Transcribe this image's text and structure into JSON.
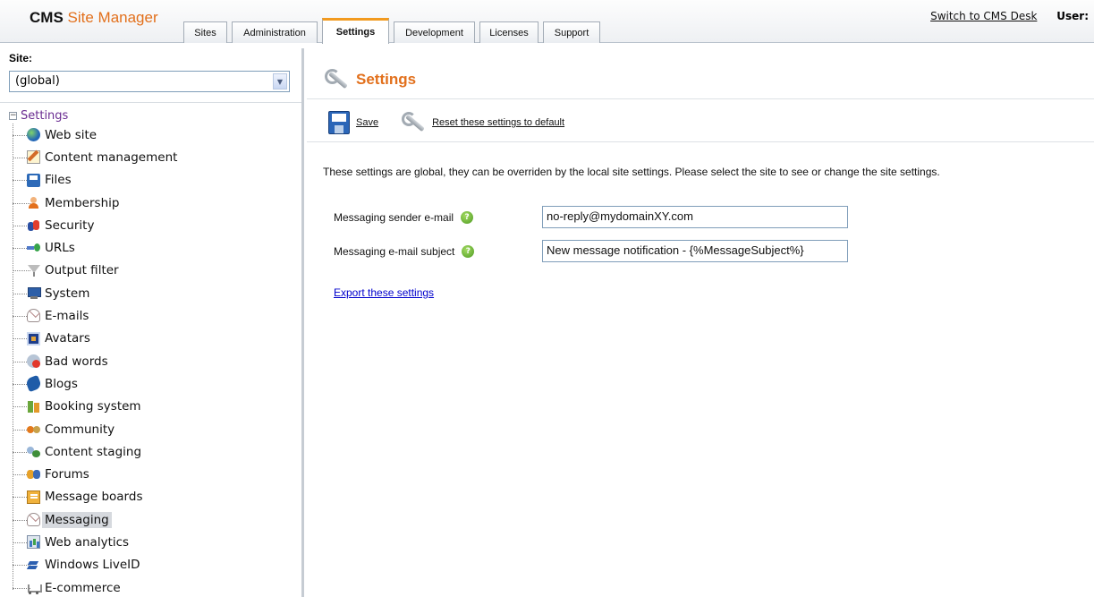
{
  "header": {
    "logo_bold": "CMS",
    "logo_text": "Site Manager",
    "tabs": [
      {
        "label": "Sites"
      },
      {
        "label": "Administration"
      },
      {
        "label": "Settings"
      },
      {
        "label": "Development"
      },
      {
        "label": "Licenses"
      },
      {
        "label": "Support"
      }
    ],
    "active_tab": "Settings",
    "switch_link": "Switch to CMS Desk",
    "user_label": "User:"
  },
  "sidebar": {
    "site_label": "Site:",
    "site_value": "(global)",
    "tree_root": "Settings",
    "tree_root_toggle": "−",
    "items": [
      {
        "label": "Web site",
        "icon": "globe-icon"
      },
      {
        "label": "Content management",
        "icon": "content-edit-icon"
      },
      {
        "label": "Files",
        "icon": "floppy-icon"
      },
      {
        "label": "Membership",
        "icon": "person-icon"
      },
      {
        "label": "Security",
        "icon": "security-icon"
      },
      {
        "label": "URLs",
        "icon": "urls-icon"
      },
      {
        "label": "Output filter",
        "icon": "filter-icon"
      },
      {
        "label": "System",
        "icon": "computer-icon"
      },
      {
        "label": "E-mails",
        "icon": "email-icon"
      },
      {
        "label": "Avatars",
        "icon": "avatar-icon"
      },
      {
        "label": "Bad words",
        "icon": "bad-words-icon"
      },
      {
        "label": "Blogs",
        "icon": "blog-icon"
      },
      {
        "label": "Booking system",
        "icon": "booking-icon"
      },
      {
        "label": "Community",
        "icon": "community-icon"
      },
      {
        "label": "Content staging",
        "icon": "staging-icon"
      },
      {
        "label": "Forums",
        "icon": "forums-icon"
      },
      {
        "label": "Message boards",
        "icon": "message-board-icon"
      },
      {
        "label": "Messaging",
        "icon": "messaging-icon",
        "selected": true
      },
      {
        "label": "Web analytics",
        "icon": "analytics-icon"
      },
      {
        "label": "Windows LiveID",
        "icon": "liveid-icon"
      },
      {
        "label": "E-commerce",
        "icon": "cart-icon"
      }
    ]
  },
  "main": {
    "title": "Settings",
    "toolbar": {
      "save_label": "Save",
      "reset_label": "Reset these settings to default"
    },
    "info_text": "These settings are global, they can be overriden by the local site settings. Please select the site to see or change the site settings.",
    "fields": [
      {
        "label": "Messaging sender e-mail",
        "value": "no-reply@mydomainXY.com"
      },
      {
        "label": "Messaging e-mail subject",
        "value": "New message notification - {%MessageSubject%}"
      }
    ],
    "help_glyph": "?",
    "export_link": "Export these settings"
  },
  "colors": {
    "accent_orange": "#e2701c",
    "tab_active_border": "#f29a1f",
    "link_blue": "#0000cc",
    "tree_root_purple": "#6a2c91"
  }
}
